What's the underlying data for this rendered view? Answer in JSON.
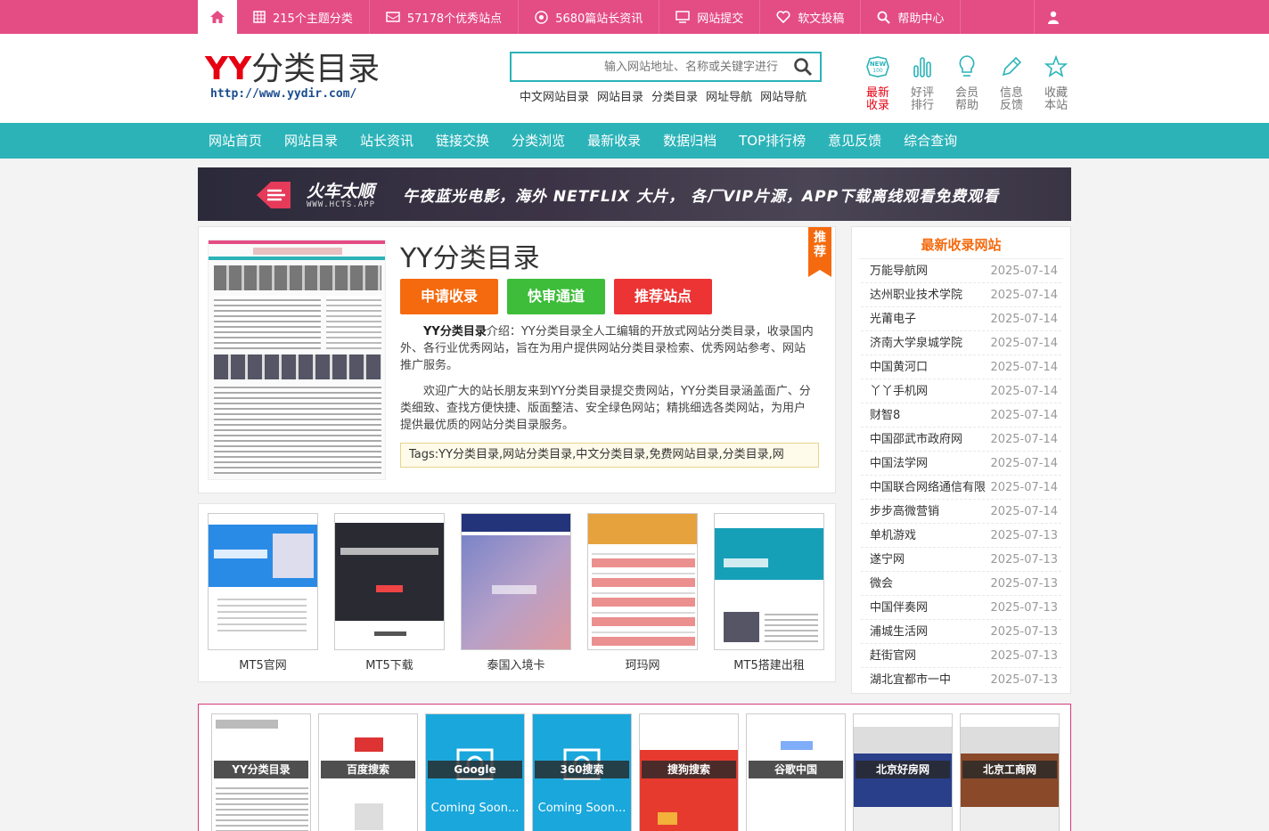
{
  "topbar": {
    "items": [
      {
        "label": "215个主题分类",
        "icon": "grid-icon"
      },
      {
        "label": "57178个优秀站点",
        "icon": "card-icon"
      },
      {
        "label": "5680篇站长资讯",
        "icon": "target-icon"
      },
      {
        "label": "网站提交",
        "icon": "monitor-icon"
      },
      {
        "label": "软文投稿",
        "icon": "heart-icon"
      },
      {
        "label": "帮助中心",
        "icon": "search-icon"
      }
    ]
  },
  "logo": {
    "text_y": "YY",
    "text_cn": "分类目录",
    "url": "http://www.yydir.com/"
  },
  "search": {
    "placeholder": "输入网站地址、名称或关键字进行",
    "tags": [
      "中文网站目录",
      "网站目录",
      "分类目录",
      "网址导航",
      "网站导航"
    ]
  },
  "quick": [
    {
      "label": "最新收录",
      "icon": "new-icon",
      "color": "#e60012"
    },
    {
      "label": "好评排行",
      "icon": "bar-chart-icon",
      "color": "#777"
    },
    {
      "label": "会员帮助",
      "icon": "bulb-icon",
      "color": "#777"
    },
    {
      "label": "信息反馈",
      "icon": "pen-icon",
      "color": "#777"
    },
    {
      "label": "收藏本站",
      "icon": "star-icon",
      "color": "#777"
    }
  ],
  "nav": [
    "网站首页",
    "网站目录",
    "站长资讯",
    "链接交换",
    "分类浏览",
    "最新收录",
    "数据归档",
    "TOP排行榜",
    "意见反馈",
    "综合查询"
  ],
  "banner": {
    "brand": "火车太顺",
    "site": "WWW.HCTS.APP",
    "text": "午夜蓝光电影，海外 NETFLIX 大片，  各厂VIP片源，APP下载离线观看免费观看"
  },
  "featured": {
    "title": "YY分类目录",
    "ribbon": "推荐",
    "buttons": [
      "申请收录",
      "快审通道",
      "推荐站点"
    ],
    "desc1_bold": "YY分类目录",
    "desc1": "介绍：YY分类目录全人工编辑的开放式网站分类目录，收录国内外、各行业优秀网站，旨在为用户提供网站分类目录检索、优秀网站参考、网站推广服务。",
    "desc2": "欢迎广大的站长朋友来到YY分类目录提交贵网站，YY分类目录涵盖面广、分类细致、查找方便快捷、版面整洁、安全绿色网站；精挑细选各类网站，为用户提供最优质的网站分类目录服务。",
    "tags": "Tags:YY分类目录,网站分类目录,中文分类目录,免费网站目录,分类目录,网"
  },
  "thumbs": [
    "MT5官网",
    "MT5下载",
    "泰国入境卡",
    "珂玛网",
    "MT5搭建出租"
  ],
  "sidebar": {
    "title": "最新收录网站",
    "rows": [
      {
        "name": "万能导航网",
        "date": "2025-07-14"
      },
      {
        "name": "达州职业技术学院",
        "date": "2025-07-14"
      },
      {
        "name": "光莆电子",
        "date": "2025-07-14"
      },
      {
        "name": "济南大学泉城学院",
        "date": "2025-07-14"
      },
      {
        "name": "中国黄河口",
        "date": "2025-07-14"
      },
      {
        "name": "丫丫手机网",
        "date": "2025-07-14"
      },
      {
        "name": "财智8",
        "date": "2025-07-14"
      },
      {
        "name": "中国邵武市政府网",
        "date": "2025-07-14"
      },
      {
        "name": "中国法学网",
        "date": "2025-07-14"
      },
      {
        "name": "中国联合网络通信有限",
        "date": "2025-07-14"
      },
      {
        "name": "步步高微营销",
        "date": "2025-07-14"
      },
      {
        "name": "单机游戏",
        "date": "2025-07-13"
      },
      {
        "name": "遂宁网",
        "date": "2025-07-13"
      },
      {
        "name": "微会",
        "date": "2025-07-13"
      },
      {
        "name": "中国伴奏网",
        "date": "2025-07-13"
      },
      {
        "name": "浦城生活网",
        "date": "2025-07-13"
      },
      {
        "name": "赶街官网",
        "date": "2025-07-13"
      },
      {
        "name": "湖北宜都市一中",
        "date": "2025-07-13"
      }
    ]
  },
  "recommend": {
    "items": [
      "YY分类目录",
      "百度搜索",
      "Google",
      "360搜索",
      "搜狗搜索",
      "谷歌中国",
      "北京好房网",
      "北京工商网"
    ],
    "coming": "Coming Soon..."
  }
}
